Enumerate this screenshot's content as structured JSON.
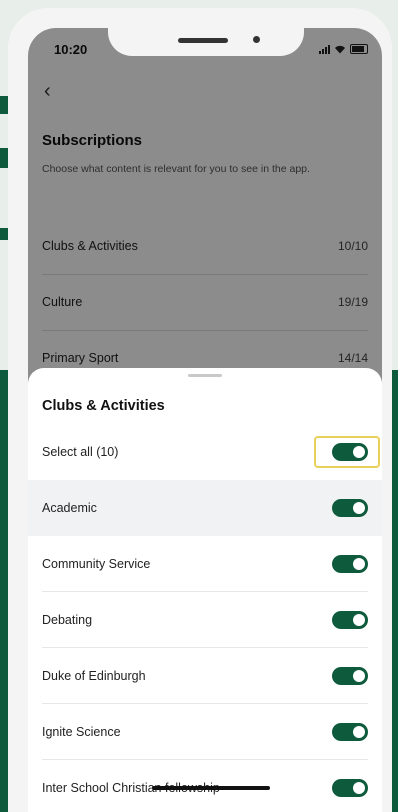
{
  "status": {
    "time": "10:20"
  },
  "page": {
    "title": "Subscriptions",
    "subtitle": "Choose what content is relevant for you to see in the app.",
    "categories": [
      {
        "label": "Clubs & Activities",
        "count": "10/10"
      },
      {
        "label": "Culture",
        "count": "19/19"
      },
      {
        "label": "Primary Sport",
        "count": "14/14"
      }
    ]
  },
  "sheet": {
    "title": "Clubs & Activities",
    "select_all_label": "Select all (10)",
    "items": [
      {
        "label": "Academic",
        "on": true
      },
      {
        "label": "Community Service",
        "on": true
      },
      {
        "label": "Debating",
        "on": true
      },
      {
        "label": "Duke of Edinburgh",
        "on": true
      },
      {
        "label": "Ignite Science",
        "on": true
      },
      {
        "label": "Inter School Christian fellowship",
        "on": true
      }
    ]
  },
  "colors": {
    "accent": "#0e5a3c",
    "focus": "#e8d15a"
  }
}
